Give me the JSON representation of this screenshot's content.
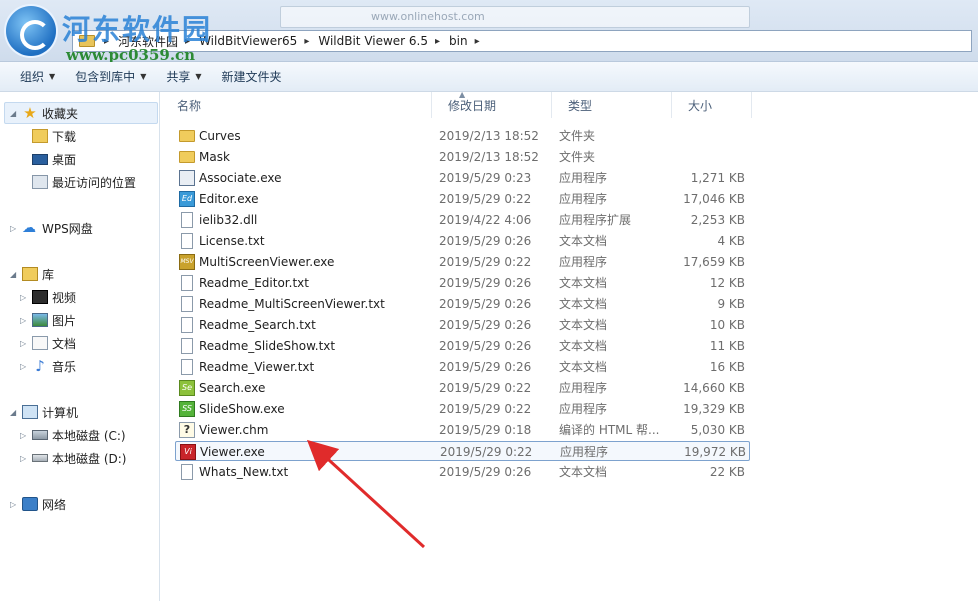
{
  "watermark": {
    "site_name": "河东软件园",
    "site_url": "www.pc0359.cn",
    "search_ghost": "www.onlinehost.com"
  },
  "address_bar": {
    "crumbs": [
      "河东软件园",
      "WildBitViewer65",
      "WildBit Viewer 6.5",
      "bin"
    ]
  },
  "toolbar": {
    "organize": "组织",
    "include_in_library": "包含到库中",
    "share": "共享",
    "new_folder": "新建文件夹"
  },
  "sidebar": {
    "favorites": "收藏夹",
    "downloads": "下载",
    "desktop": "桌面",
    "recent": "最近访问的位置",
    "wps_cloud": "WPS网盘",
    "libraries": "库",
    "videos": "视频",
    "pictures": "图片",
    "documents": "文档",
    "music": "音乐",
    "computer": "计算机",
    "drive_c": "本地磁盘 (C:)",
    "drive_d": "本地磁盘 (D:)",
    "network": "网络"
  },
  "columns": {
    "name": "名称",
    "modified": "修改日期",
    "type": "类型",
    "size": "大小"
  },
  "files": [
    {
      "name": "Curves",
      "date": "2019/2/13 18:52",
      "type": "文件夹",
      "size": "",
      "icon": "folder-icon"
    },
    {
      "name": "Mask",
      "date": "2019/2/13 18:52",
      "type": "文件夹",
      "size": "",
      "icon": "folder-icon"
    },
    {
      "name": "Associate.exe",
      "date": "2019/5/29 0:23",
      "type": "应用程序",
      "size": "1,271 KB",
      "icon": "associate-exe-icon"
    },
    {
      "name": "Editor.exe",
      "date": "2019/5/29 0:22",
      "type": "应用程序",
      "size": "17,046 KB",
      "icon": "editor-exe-icon"
    },
    {
      "name": "ielib32.dll",
      "date": "2019/4/22 4:06",
      "type": "应用程序扩展",
      "size": "2,253 KB",
      "icon": "dll-file-icon"
    },
    {
      "name": "License.txt",
      "date": "2019/5/29 0:26",
      "type": "文本文档",
      "size": "4 KB",
      "icon": "text-file-icon"
    },
    {
      "name": "MultiScreenViewer.exe",
      "date": "2019/5/29 0:22",
      "type": "应用程序",
      "size": "17,659 KB",
      "icon": "msv-exe-icon"
    },
    {
      "name": "Readme_Editor.txt",
      "date": "2019/5/29 0:26",
      "type": "文本文档",
      "size": "12 KB",
      "icon": "text-file-icon"
    },
    {
      "name": "Readme_MultiScreenViewer.txt",
      "date": "2019/5/29 0:26",
      "type": "文本文档",
      "size": "9 KB",
      "icon": "text-file-icon"
    },
    {
      "name": "Readme_Search.txt",
      "date": "2019/5/29 0:26",
      "type": "文本文档",
      "size": "10 KB",
      "icon": "text-file-icon"
    },
    {
      "name": "Readme_SlideShow.txt",
      "date": "2019/5/29 0:26",
      "type": "文本文档",
      "size": "11 KB",
      "icon": "text-file-icon"
    },
    {
      "name": "Readme_Viewer.txt",
      "date": "2019/5/29 0:26",
      "type": "文本文档",
      "size": "16 KB",
      "icon": "text-file-icon"
    },
    {
      "name": "Search.exe",
      "date": "2019/5/29 0:22",
      "type": "应用程序",
      "size": "14,660 KB",
      "icon": "search-exe-icon"
    },
    {
      "name": "SlideShow.exe",
      "date": "2019/5/29 0:22",
      "type": "应用程序",
      "size": "19,329 KB",
      "icon": "slideshow-exe-icon"
    },
    {
      "name": "Viewer.chm",
      "date": "2019/5/29 0:18",
      "type": "编译的 HTML 帮...",
      "size": "5,030 KB",
      "icon": "chm-help-icon"
    },
    {
      "name": "Viewer.exe",
      "date": "2019/5/29 0:22",
      "type": "应用程序",
      "size": "19,972 KB",
      "icon": "viewer-exe-icon"
    },
    {
      "name": "Whats_New.txt",
      "date": "2019/5/29 0:26",
      "type": "文本文档",
      "size": "22 KB",
      "icon": "text-file-icon"
    }
  ],
  "selected_file": "Viewer.exe",
  "colors": {
    "annotation_arrow": "#e02b2b",
    "selection_border": "#7da2ce"
  }
}
